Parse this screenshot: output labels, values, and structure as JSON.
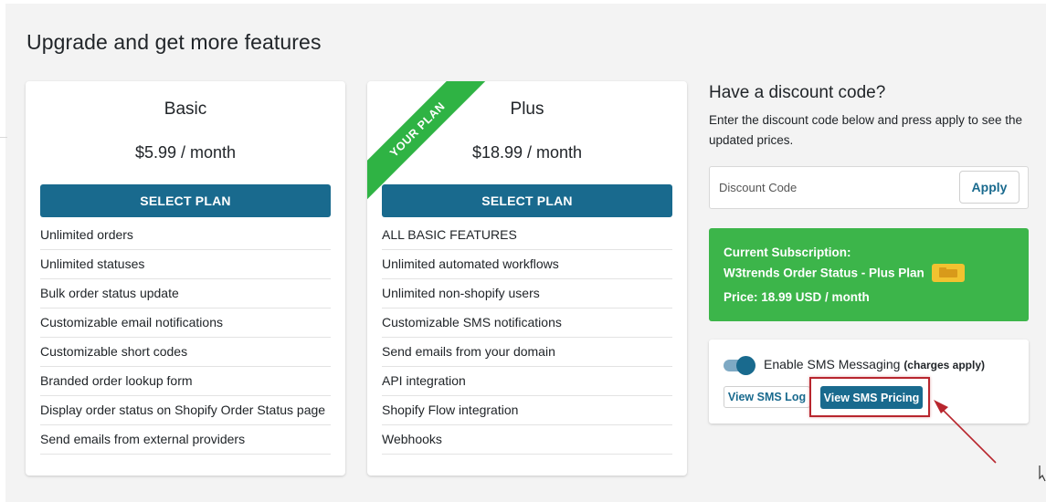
{
  "heading": "Upgrade and get more features",
  "plans": [
    {
      "name": "Basic",
      "price": "$5.99 / month",
      "button_label": "SELECT PLAN",
      "features": [
        "Unlimited orders",
        "Unlimited statuses",
        "Bulk order status update",
        "Customizable email notifications",
        "Customizable short codes",
        "Branded order lookup form",
        "Display order status on Shopify Order Status page",
        "Send emails from external providers"
      ]
    },
    {
      "name": "Plus",
      "price": "$18.99 / month",
      "button_label": "SELECT PLAN",
      "ribbon": "YOUR PLAN",
      "features": [
        "ALL BASIC FEATURES",
        "Unlimited automated workflows",
        "Unlimited non-shopify users",
        "Customizable SMS notifications",
        "Send emails from your domain",
        "API integration",
        "Shopify Flow integration",
        "Webhooks"
      ]
    }
  ],
  "discount": {
    "title": "Have a discount code?",
    "description": "Enter the discount code below and press apply to see the updated prices.",
    "placeholder": "Discount Code",
    "apply_label": "Apply"
  },
  "subscription": {
    "label": "Current Subscription:",
    "plan": "W3trends Order Status - Plus Plan",
    "badge_icon": "wallet-icon",
    "price": "Price: 18.99 USD / month"
  },
  "sms": {
    "toggle_on": true,
    "label": "Enable SMS Messaging",
    "charges": "(charges apply)",
    "log_button": "View SMS Log",
    "pricing_button": "View SMS Pricing"
  },
  "colors": {
    "primary": "#196a8e",
    "success": "#3cb54a",
    "ribbon": "#2fb344",
    "annotation": "#b8262e",
    "badge": "#f2c230"
  }
}
